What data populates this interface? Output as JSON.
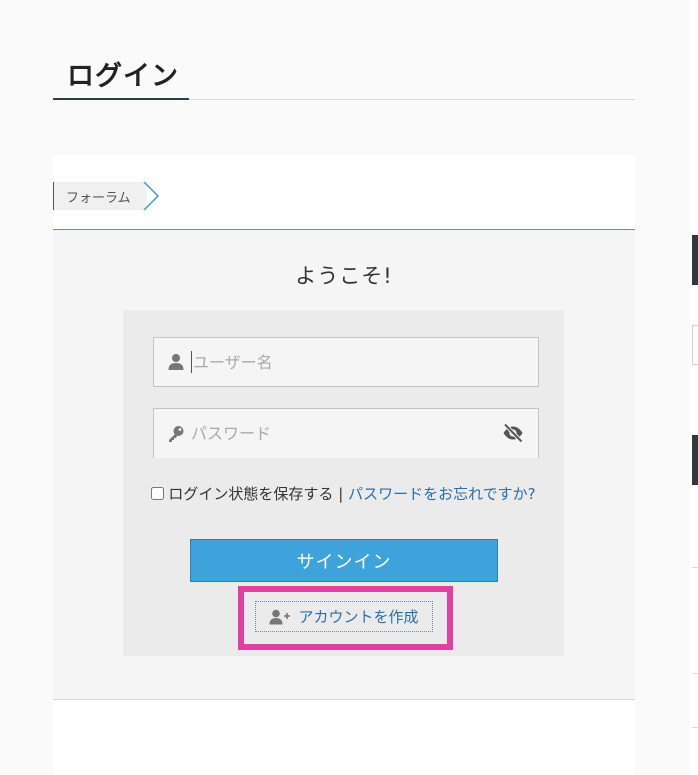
{
  "page": {
    "title": "ログイン"
  },
  "breadcrumb": {
    "items": [
      "フォーラム"
    ]
  },
  "login": {
    "welcome": "ようこそ!",
    "username_placeholder": "ユーザー名",
    "password_placeholder": "パスワード",
    "remember_label": "ログイン状態を保存する",
    "separator": "|",
    "forgot_link": "パスワードをお忘れですか?",
    "signin_button": "サインイン",
    "create_account_button": "アカウントを作成"
  },
  "icons": {
    "username": "user-icon",
    "password": "key-icon",
    "toggle_password": "eye-slash-icon",
    "create_account": "user-plus-icon",
    "breadcrumb_separator": "chevron-right-icon"
  },
  "colors": {
    "primary_button": "#3fa3db",
    "link": "#2a6fa8",
    "highlight": "#e040a0",
    "breadcrumb_rule": "#4a98c9"
  }
}
